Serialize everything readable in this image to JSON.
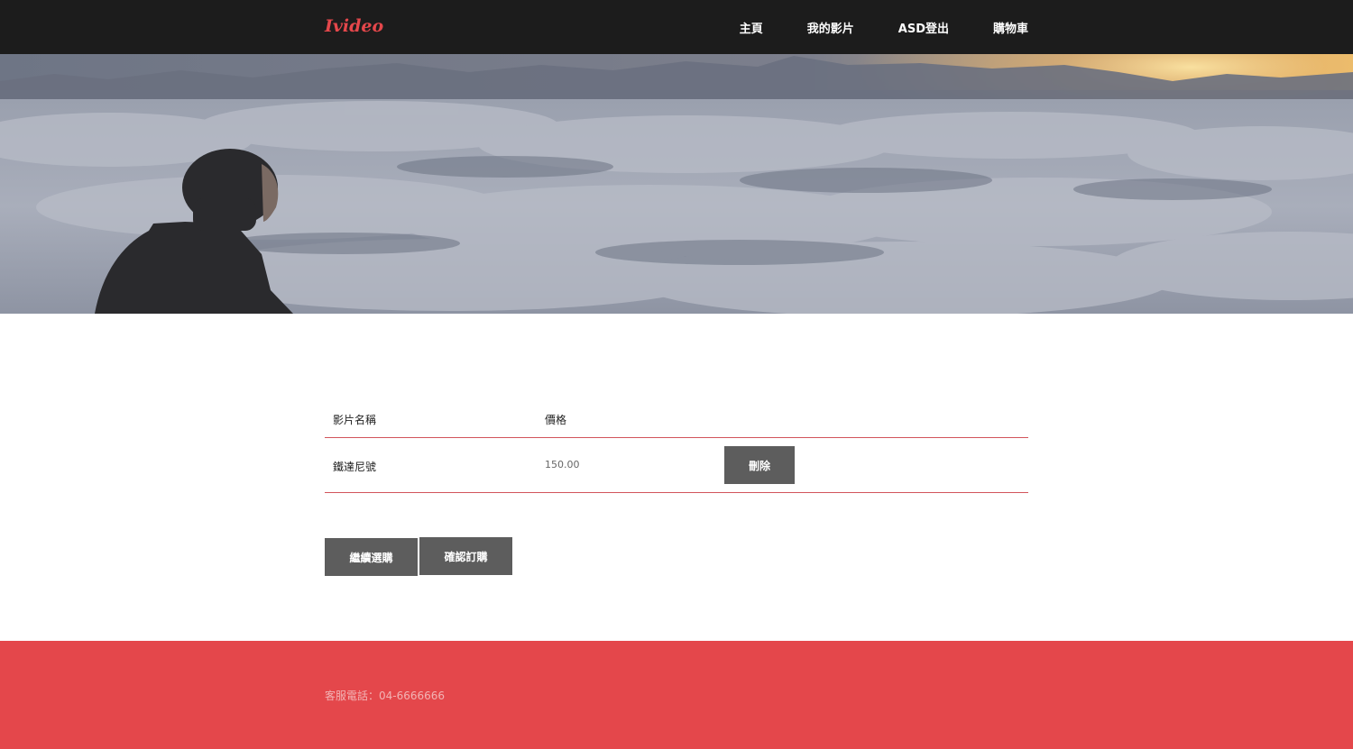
{
  "brand": {
    "name": "Ivideo",
    "color": "#e4474b"
  },
  "nav": {
    "items": [
      {
        "label": "主頁"
      },
      {
        "label": "我的影片"
      },
      {
        "label": "ASD登出"
      },
      {
        "label": "購物車"
      }
    ]
  },
  "hero": {
    "image": "person-looking-over-sea-of-clouds-at-sunrise"
  },
  "cart": {
    "headers": {
      "name": "影片名稱",
      "price": "價格"
    },
    "rows": [
      {
        "name": "鐵達尼號",
        "price": "150.00",
        "delete_label": "刪除"
      }
    ],
    "border_color": "#d2555b"
  },
  "actions": {
    "continue_label": "繼續選購",
    "confirm_label": "確認訂購",
    "button_color": "#5d5d5d"
  },
  "footer": {
    "text": "客服電話：04-6666666",
    "background": "#e4474b"
  }
}
